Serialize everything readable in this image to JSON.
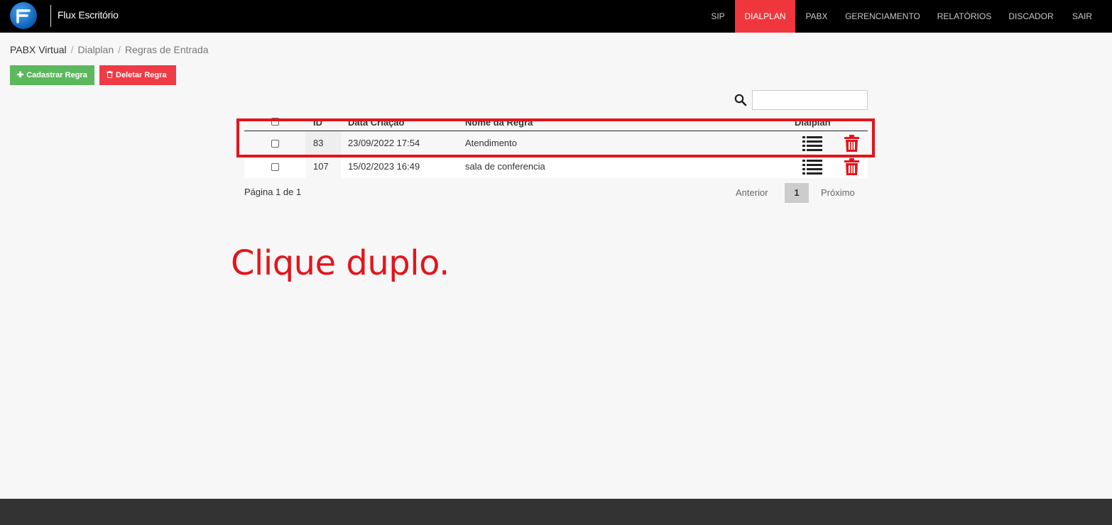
{
  "brand": {
    "name": "Flux Escritório"
  },
  "nav": {
    "items": [
      {
        "label": "SIP"
      },
      {
        "label": "DIALPLAN"
      },
      {
        "label": "PABX"
      },
      {
        "label": "GERENCIAMENTO"
      },
      {
        "label": "RELATÓRIOS"
      },
      {
        "label": "DISCADOR"
      },
      {
        "label": "SAIR"
      }
    ],
    "active": "DIALPLAN",
    "active_color": "#f0363d"
  },
  "breadcrumb": [
    "PABX Virtual",
    "Dialplan",
    "Regras de Entrada"
  ],
  "toolbar": {
    "add_label": "Cadastrar Regra",
    "delete_label": "Deletar Regra"
  },
  "table": {
    "headers": {
      "id": "ID",
      "date": "Data Criação",
      "name": "Nome da Regra",
      "dialplan": "Dialplan"
    },
    "rows": [
      {
        "id": "83",
        "date": "23/09/2022 17:54",
        "name": "Atendimento"
      },
      {
        "id": "107",
        "date": "15/02/2023 16:49",
        "name": "sala de conferencia"
      }
    ]
  },
  "pagination": {
    "info": "Página 1 de 1",
    "prev": "Anterior",
    "current": "1",
    "next": "Próximo"
  },
  "annotation": {
    "text": "Clique duplo.",
    "color": "#e5141c"
  },
  "icons": [
    "search-icon",
    "list-icon",
    "trash-icon",
    "plus-icon",
    "logo-icon"
  ]
}
